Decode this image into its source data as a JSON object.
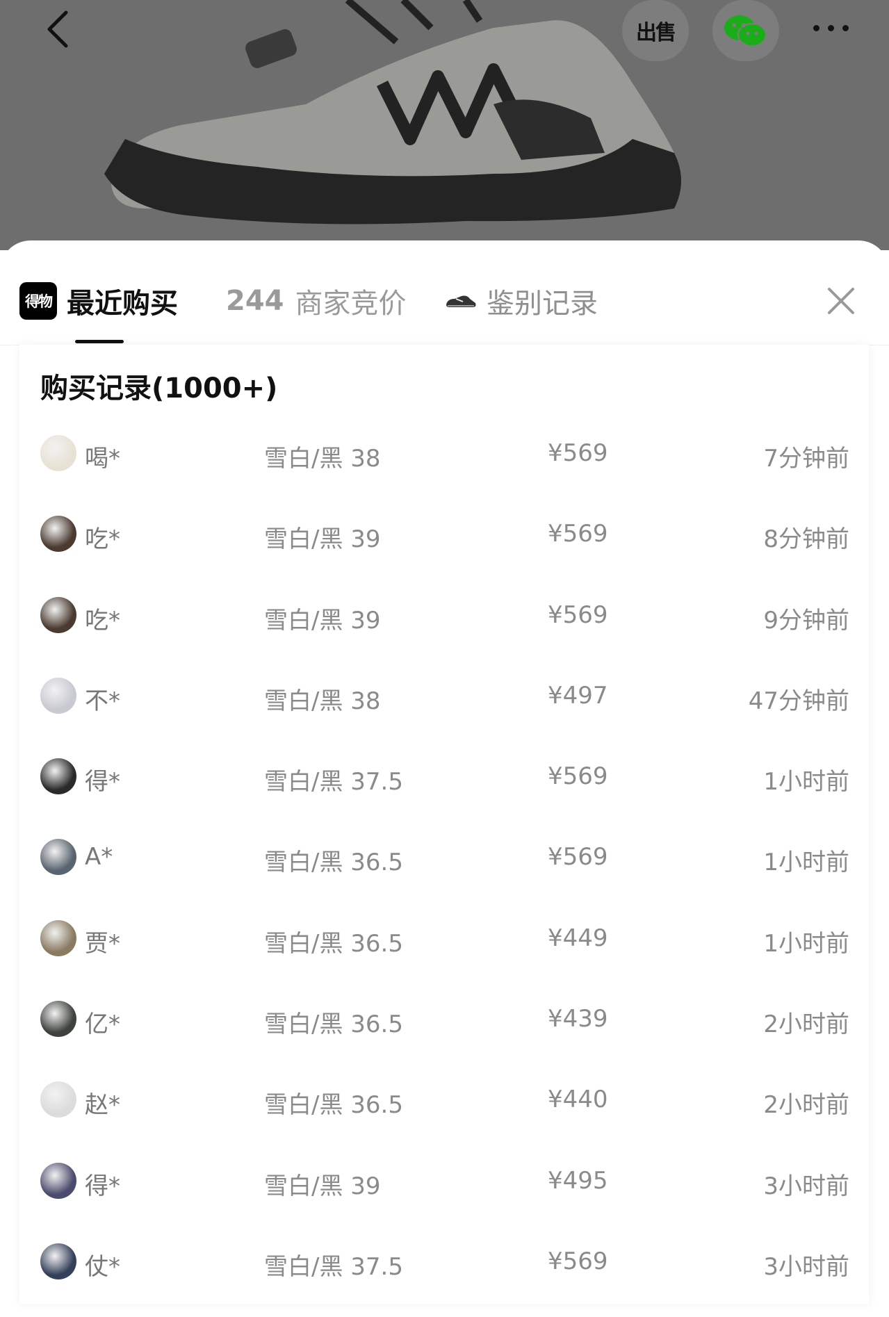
{
  "header": {
    "sell_label": "出售"
  },
  "tabs": {
    "recent": {
      "logo_text": "得物",
      "label": "最近购买"
    },
    "bids": {
      "count": "244",
      "label": "商家竞价"
    },
    "auth": {
      "label": "鉴别记录"
    }
  },
  "records": {
    "title": "购买记录(1000+)",
    "rows": [
      {
        "user": "喝*",
        "spec": "雪白/黑 38",
        "price": "¥569",
        "time": "7分钟前",
        "avatar_color": "#e8e2d6"
      },
      {
        "user": "吃*",
        "spec": "雪白/黑 39",
        "price": "¥569",
        "time": "8分钟前",
        "avatar_color": "#4a3a30"
      },
      {
        "user": "吃*",
        "spec": "雪白/黑 39",
        "price": "¥569",
        "time": "9分钟前",
        "avatar_color": "#4a3a30"
      },
      {
        "user": "不*",
        "spec": "雪白/黑 38",
        "price": "¥497",
        "time": "47分钟前",
        "avatar_color": "#c9c9d2"
      },
      {
        "user": "得*",
        "spec": "雪白/黑 37.5",
        "price": "¥569",
        "time": "1小时前",
        "avatar_color": "#2a2a2a"
      },
      {
        "user": "A*",
        "spec": "雪白/黑 36.5",
        "price": "¥569",
        "time": "1小时前",
        "avatar_color": "#5a6470"
      },
      {
        "user": "贾*",
        "spec": "雪白/黑 36.5",
        "price": "¥449",
        "time": "1小时前",
        "avatar_color": "#8a7a60"
      },
      {
        "user": "亿*",
        "spec": "雪白/黑 36.5",
        "price": "¥439",
        "time": "2小时前",
        "avatar_color": "#3e423c"
      },
      {
        "user": "赵*",
        "spec": "雪白/黑 36.5",
        "price": "¥440",
        "time": "2小时前",
        "avatar_color": "#dcdcdc"
      },
      {
        "user": "得*",
        "spec": "雪白/黑 39",
        "price": "¥495",
        "time": "3小时前",
        "avatar_color": "#4b4b6e"
      },
      {
        "user": "仗*",
        "spec": "雪白/黑 37.5",
        "price": "¥569",
        "time": "3小时前",
        "avatar_color": "#34405a"
      }
    ]
  }
}
